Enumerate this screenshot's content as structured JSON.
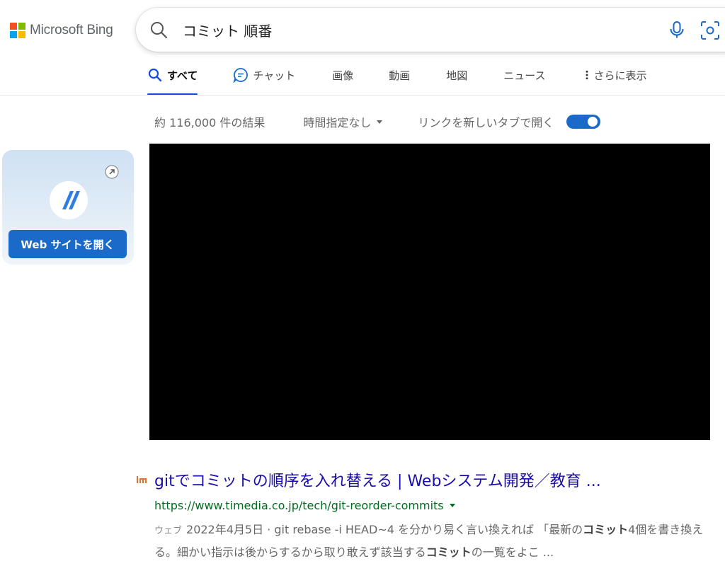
{
  "brand": {
    "name": "Microsoft Bing",
    "colors": [
      "#f25022",
      "#7fba00",
      "#00a4ef",
      "#ffb900"
    ]
  },
  "search": {
    "query": "コミット 順番",
    "icon": "search-icon",
    "mic_icon": "mic-icon",
    "visual_icon": "visual-search-icon"
  },
  "tabs": [
    {
      "label": "すべて",
      "icon": "search-icon",
      "active": true
    },
    {
      "label": "チャット",
      "icon": "chat-icon"
    },
    {
      "label": "画像"
    },
    {
      "label": "動画"
    },
    {
      "label": "地図"
    },
    {
      "label": "ニュース"
    },
    {
      "label": "さらに表示",
      "icon": "more-vertical-icon"
    }
  ],
  "toolbar": {
    "result_count": "約 116,000 件の結果",
    "time_filter": "時間指定なし",
    "new_tab_label": "リンクを新しいタブで開く",
    "new_tab_enabled": true
  },
  "site_card": {
    "button_label": "Web サイトを開く",
    "icon": "external-link-icon"
  },
  "result": {
    "title": "gitでコミットの順序を入れ替える | Webシステム開発／教育 ...",
    "url": "https://www.timedia.co.jp/tech/git-reorder-commits",
    "snippet_badge": "ウェブ",
    "snippet_parts": [
      {
        "text": "2022年4月5日 · git rebase -i HEAD~4 を分かり易く言い換えれば 「最新の",
        "bold": false
      },
      {
        "text": "コミット",
        "bold": true
      },
      {
        "text": "4個を書き換える。細かい指示は後からするから取り敢えず該当する",
        "bold": false
      },
      {
        "text": "コミット",
        "bold": true
      },
      {
        "text": "の一覧をよこ ...",
        "bold": false
      }
    ]
  },
  "accent_colors": {
    "link": "#1a0dab",
    "url": "#006d21",
    "primary": "#1b6ac9",
    "active_tab": "#174ae4"
  }
}
